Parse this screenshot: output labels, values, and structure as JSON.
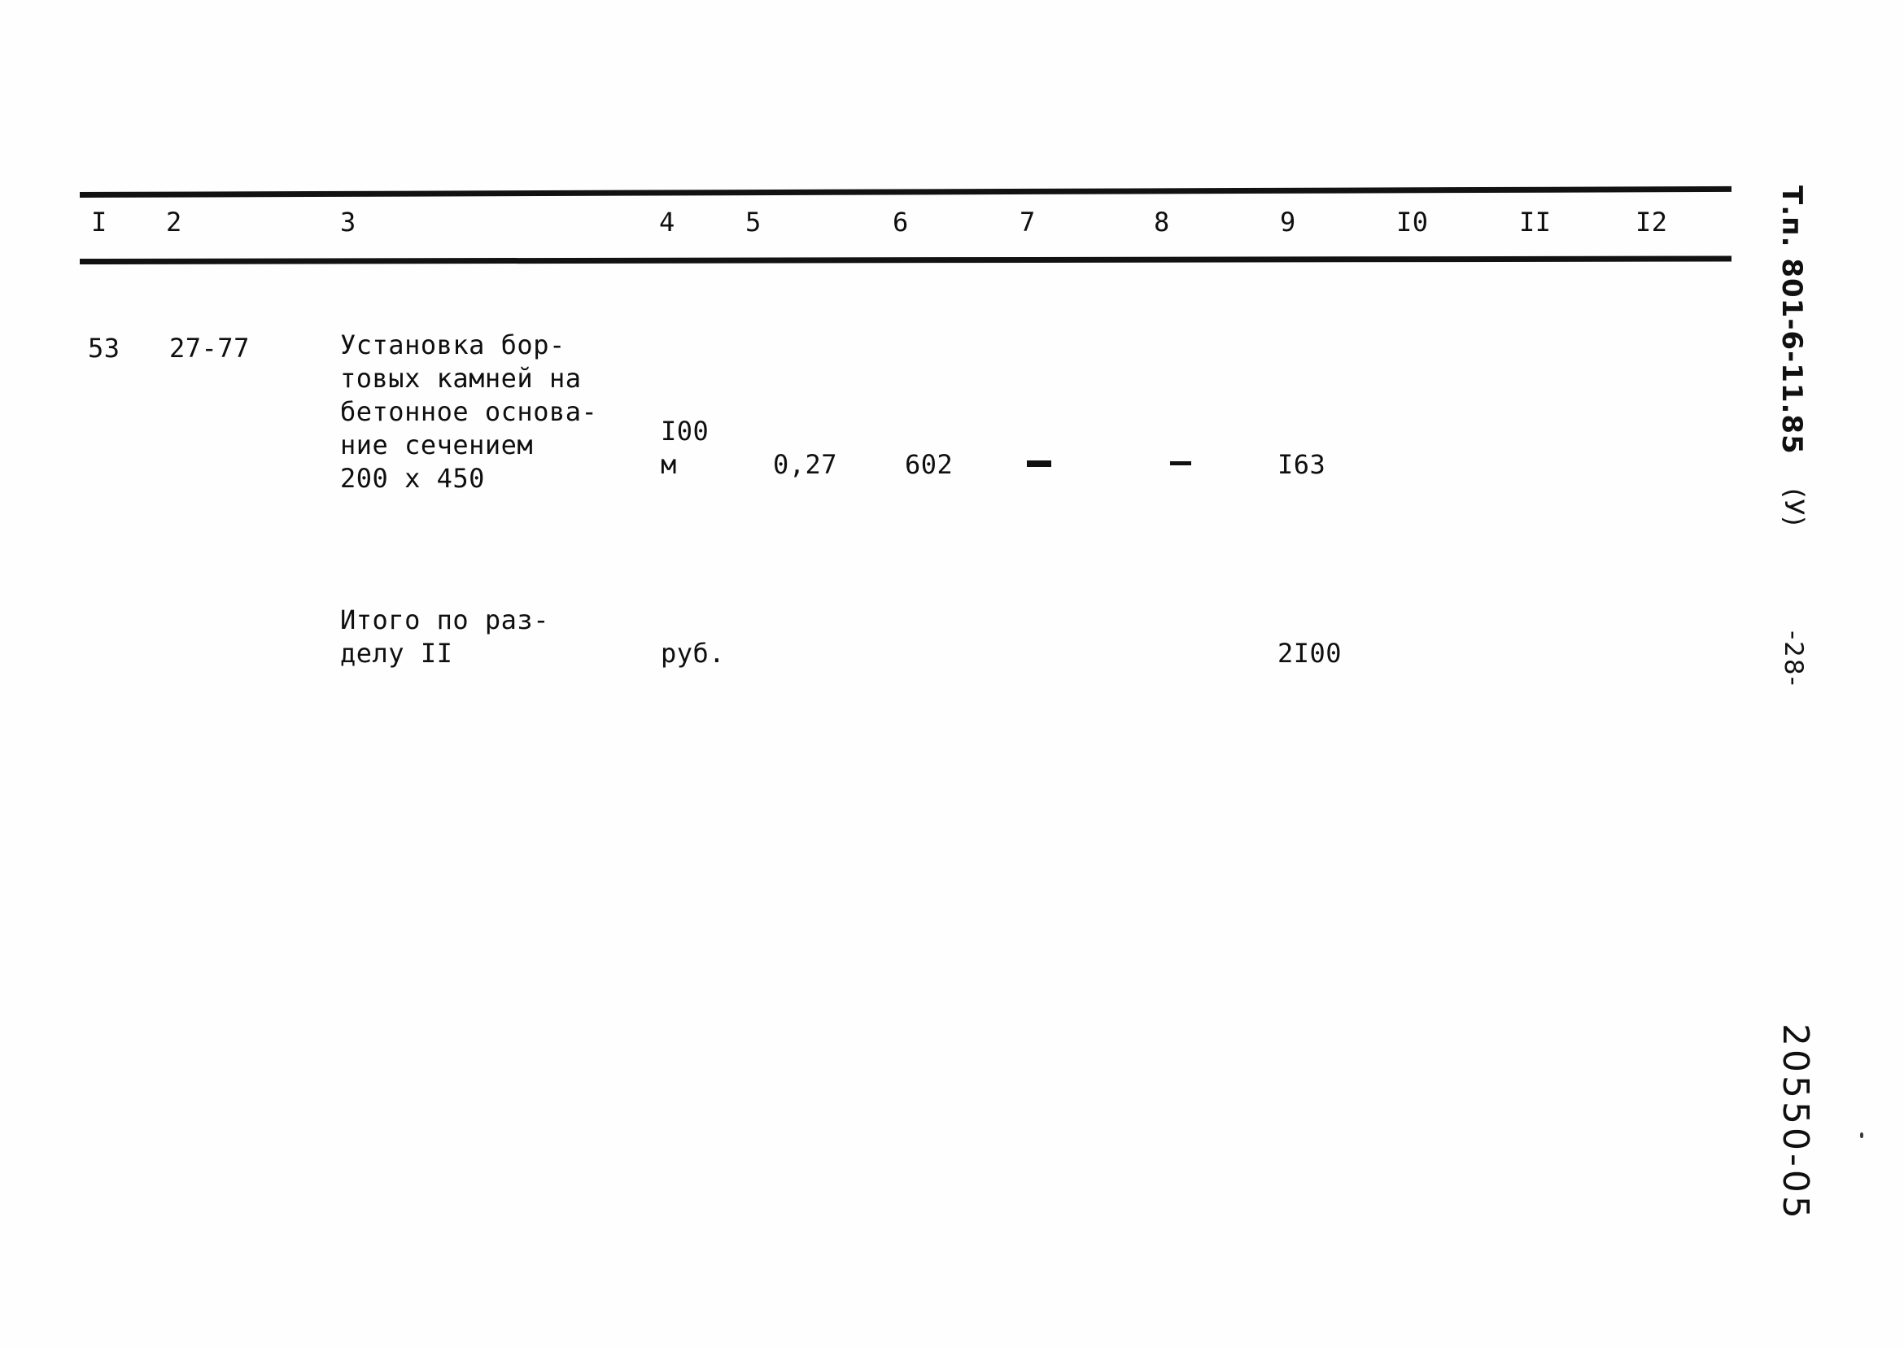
{
  "document": {
    "kind": "scanned-cost-estimate-table",
    "background_color": "#fefefe",
    "ink_color": "#0f0f0f"
  },
  "table": {
    "column_headers": [
      "I",
      "2",
      "3",
      "4",
      "5",
      "6",
      "7",
      "8",
      "9",
      "I0",
      "II",
      "I2"
    ],
    "rows": [
      {
        "kind": "item",
        "c1": "53",
        "c2": "27-77",
        "c3_lines": [
          "Установка бор-",
          "товых камней на",
          "бетонное основа-",
          "ние сечением",
          "200 х 450"
        ],
        "c4_lines": [
          "I00",
          "м"
        ],
        "c5": "0,27",
        "c6": "602",
        "c7": "-",
        "c8": "-",
        "c9": "I63",
        "c10": "",
        "c11": "",
        "c12": ""
      },
      {
        "kind": "subtotal",
        "c1": "",
        "c2": "",
        "c3_lines": [
          "Итого по раз-",
          "делу II"
        ],
        "c4_lines": [
          "руб."
        ],
        "c5": "",
        "c6": "",
        "c7": "",
        "c8": "",
        "c9": "2I00",
        "c10": "",
        "c11": "",
        "c12": ""
      }
    ]
  },
  "margin_notes": {
    "project_code": "Т.п. 801-6-11.85",
    "variant_mark": "(У)",
    "page_number": "-28-",
    "archive_number": "20550-05"
  }
}
